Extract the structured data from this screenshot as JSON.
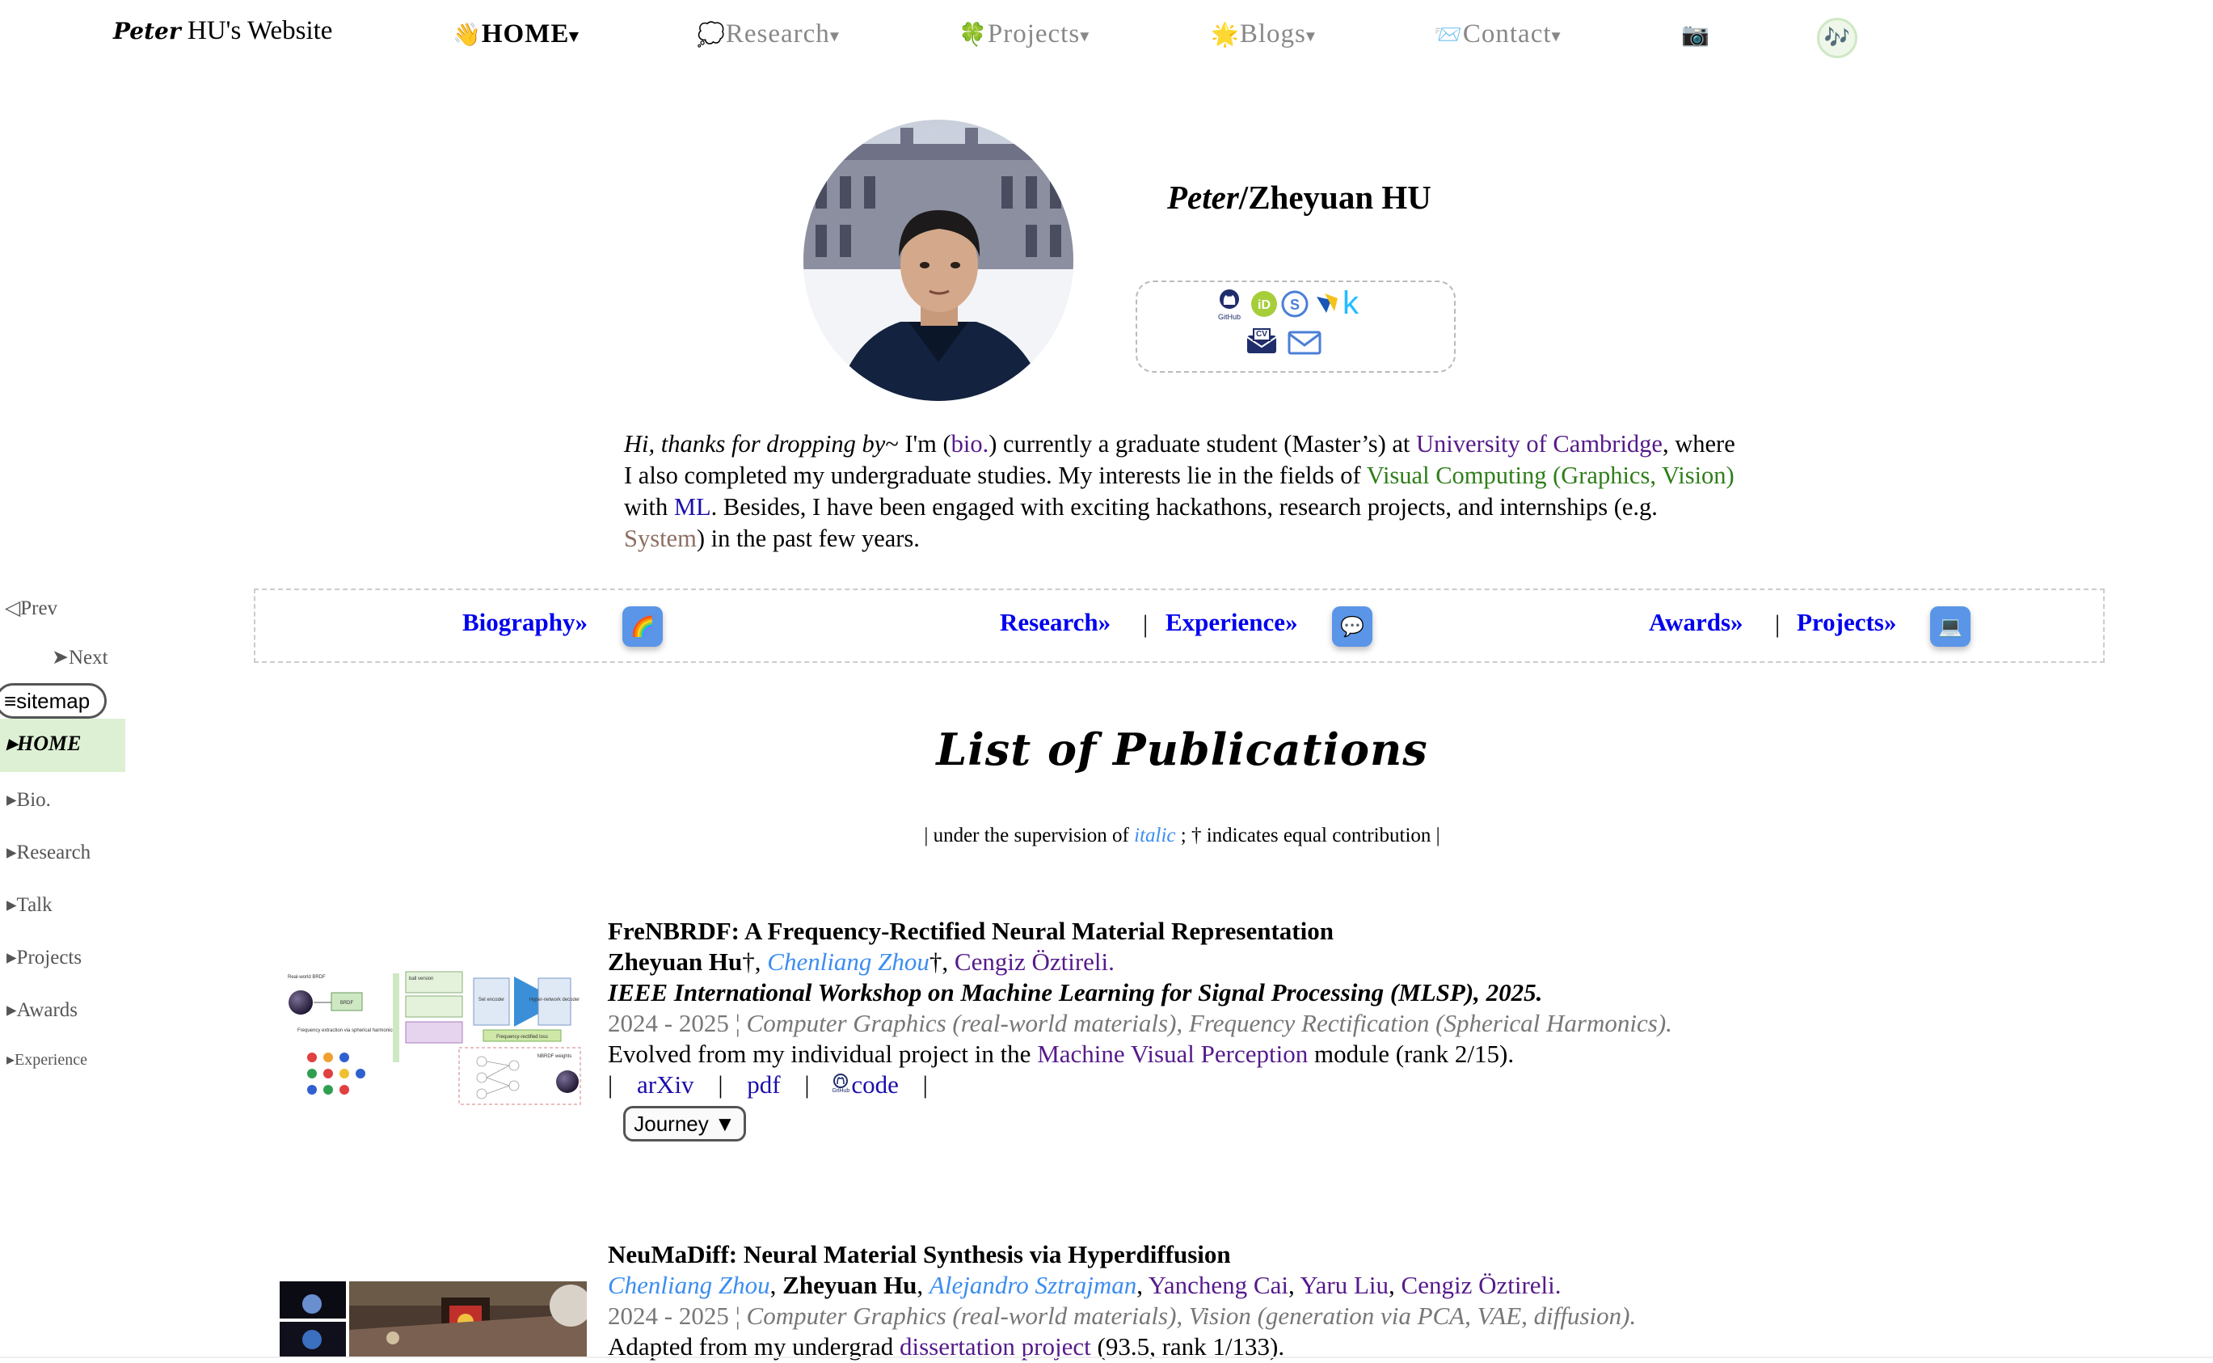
{
  "nav": {
    "site_title_italic": "Peter",
    "site_title_rest": " HU's Website",
    "items": [
      {
        "icon": "👋",
        "label": "HOME",
        "active": true
      },
      {
        "icon": "💭",
        "label": "Research"
      },
      {
        "icon": "🍀",
        "label": "Projects"
      },
      {
        "icon": "🌟",
        "label": "Blogs"
      },
      {
        "icon": "📨",
        "label": "Contact"
      }
    ],
    "camera_icon": "📷",
    "music_icon": "🎶",
    "caret": "▾"
  },
  "profile": {
    "name_italic": "Peter",
    "name_rest": "/Zheyuan HU",
    "social_icons": [
      "github-icon",
      "orcid-icon",
      "google-scholar-icon",
      "semantic-scholar-icon",
      "kaggle-icon",
      "cv-icon",
      "email-icon"
    ],
    "github_label": "GitHub",
    "cv_label": "CV",
    "kaggle_glyph": "k"
  },
  "intro": {
    "greeting": "Hi, thanks for dropping by",
    "t1": "~ I'm (",
    "bio_link": "bio.",
    "t2": ") currently a graduate student (Master’s) at ",
    "university_link": "University of Cambridge",
    "t3": ", where I also completed my undergraduate studies. My interests lie in the fields of ",
    "vc_link": "Visual Computing (Graphics, Vision)",
    "t4": " with ",
    "ml_link": "ML",
    "t5": ". Besides, I have been engaged with exciting hackathons, research projects, and internships (e.g. ",
    "system_link": "System",
    "t6": ") in the past few years."
  },
  "section_bar": {
    "biography": "Biography»",
    "research": "Research»",
    "experience": "Experience»",
    "awards": "Awards»",
    "projects": "Projects»",
    "sep": "|",
    "btn1_icon": "🌈",
    "btn2_icon": "💬",
    "btn3_icon": "💻"
  },
  "sidenav": {
    "prev": "◁Prev",
    "next": "➤Next",
    "sitemap": "≡sitemap",
    "items": [
      "▸HOME",
      "▸Bio.",
      "▸Research",
      "▸Talk",
      "▸Projects",
      "▸Awards",
      "▸Experience"
    ]
  },
  "publications": {
    "heading": "List of Publications",
    "note_pre": "| under the supervision of ",
    "note_italic": "italic",
    "note_post": " ; † indicates equal contribution |",
    "pub1": {
      "title": "FreNBRDF: A Frequency-Rectified Neural Material Representation",
      "author1": "Zheyuan Hu",
      "dagger": "†",
      "comma": ", ",
      "author2": "Chenliang Zhou",
      "author3": "Cengiz Öztireli",
      "period": ".",
      "venue": "IEEE International Workshop on Machine Learning for Signal Processing (MLSP), 2025.",
      "years": "2024 - 2025 ¦ ",
      "topics": "Computer Graphics (real-world materials), Frequency Rectification (Spherical Harmonics).",
      "desc_pre": "Evolved from my individual project in the ",
      "desc_link": "Machine Visual Perception",
      "desc_post": " module (rank 2/15).",
      "link_arxiv": "arXiv",
      "link_pdf": "pdf",
      "link_code": "code",
      "code_icon_label": "GitHub",
      "sep": "|",
      "journey_button": "Journey ▼",
      "thumb_labels": [
        "Real-world BRDF",
        "BRDF",
        "Frequency extraction via spherical harmonics",
        "ball version",
        "Set encoder",
        "Hyper-network decoder",
        "Frequency-rectified loss",
        "NBRDF weights"
      ]
    },
    "pub2": {
      "title": "NeuMaDiff: Neural Material Synthesis via Hyperdiffusion",
      "author1": "Chenliang Zhou",
      "author2": "Zheyuan Hu",
      "author3": "Alejandro Sztrajman",
      "author4": "Yancheng Cai",
      "author5": "Yaru Liu",
      "author6": "Cengiz Öztireli",
      "comma": ", ",
      "period": ".",
      "years": "2024 - 2025 ¦ ",
      "topics": "Computer Graphics (real-world materials), Vision (generation via PCA, VAE, diffusion).",
      "desc_pre": "Adapted from my undergrad ",
      "desc_link": "dissertation project",
      "desc_post": " (93.5, rank 1/133)."
    }
  }
}
